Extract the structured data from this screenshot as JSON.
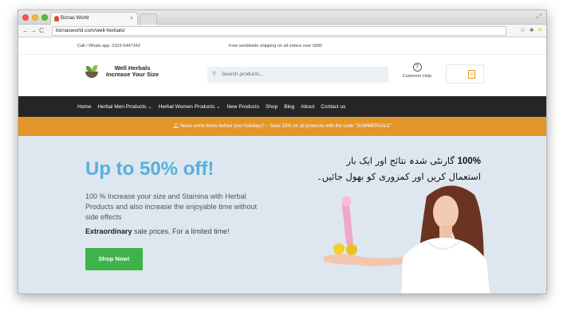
{
  "browser": {
    "tab_title": "Biznas World",
    "tab_close": "×",
    "url": "biznasworld.com/well-herbals/",
    "back": "←",
    "forward": "→",
    "reload": "C"
  },
  "topbar": {
    "phone": "Call / Whats app: 0323-5447342",
    "shipping": "Free worldwide shipping on all orders over 5000"
  },
  "header": {
    "logo_line1": "Well Herbals",
    "logo_line2": "Increase Your Size",
    "search_placeholder": "Search products...",
    "help_label": "Customer Help",
    "cart_count": "0"
  },
  "nav": {
    "items": [
      {
        "label": "Home"
      },
      {
        "label": "Herbal Men Products ⌄"
      },
      {
        "label": "Herbal Women Products ⌄"
      },
      {
        "label": "New Products"
      },
      {
        "label": "Shop"
      },
      {
        "label": "Blog"
      },
      {
        "label": "About"
      },
      {
        "label": "Contact us"
      }
    ]
  },
  "promo": {
    "text": "Need some items before your holidays? – Save 25% on all products with the code \"SUMMERSALE\""
  },
  "hero": {
    "heading": "Up to 50% off!",
    "description": "100 % Increase your size and Stamina with Herbal Products and also increase the enjoyable time without side effects",
    "sub_bold": "Extraordinary",
    "sub_rest": " sale prices. For a limited time!",
    "cta": "Shop Now!",
    "urdu_bold": "100%",
    "urdu_line1": " گارنٹی شدہ نتائج اور ایک بار",
    "urdu_line2": "استعمال کریں اور کمزوری کو بھول جائیں۔"
  },
  "colors": {
    "nav_bg": "#252525",
    "promo_bg": "#e2962a",
    "hero_bg": "#dee6ef",
    "heading": "#55b0dd",
    "cta_bg": "#3db34a"
  }
}
